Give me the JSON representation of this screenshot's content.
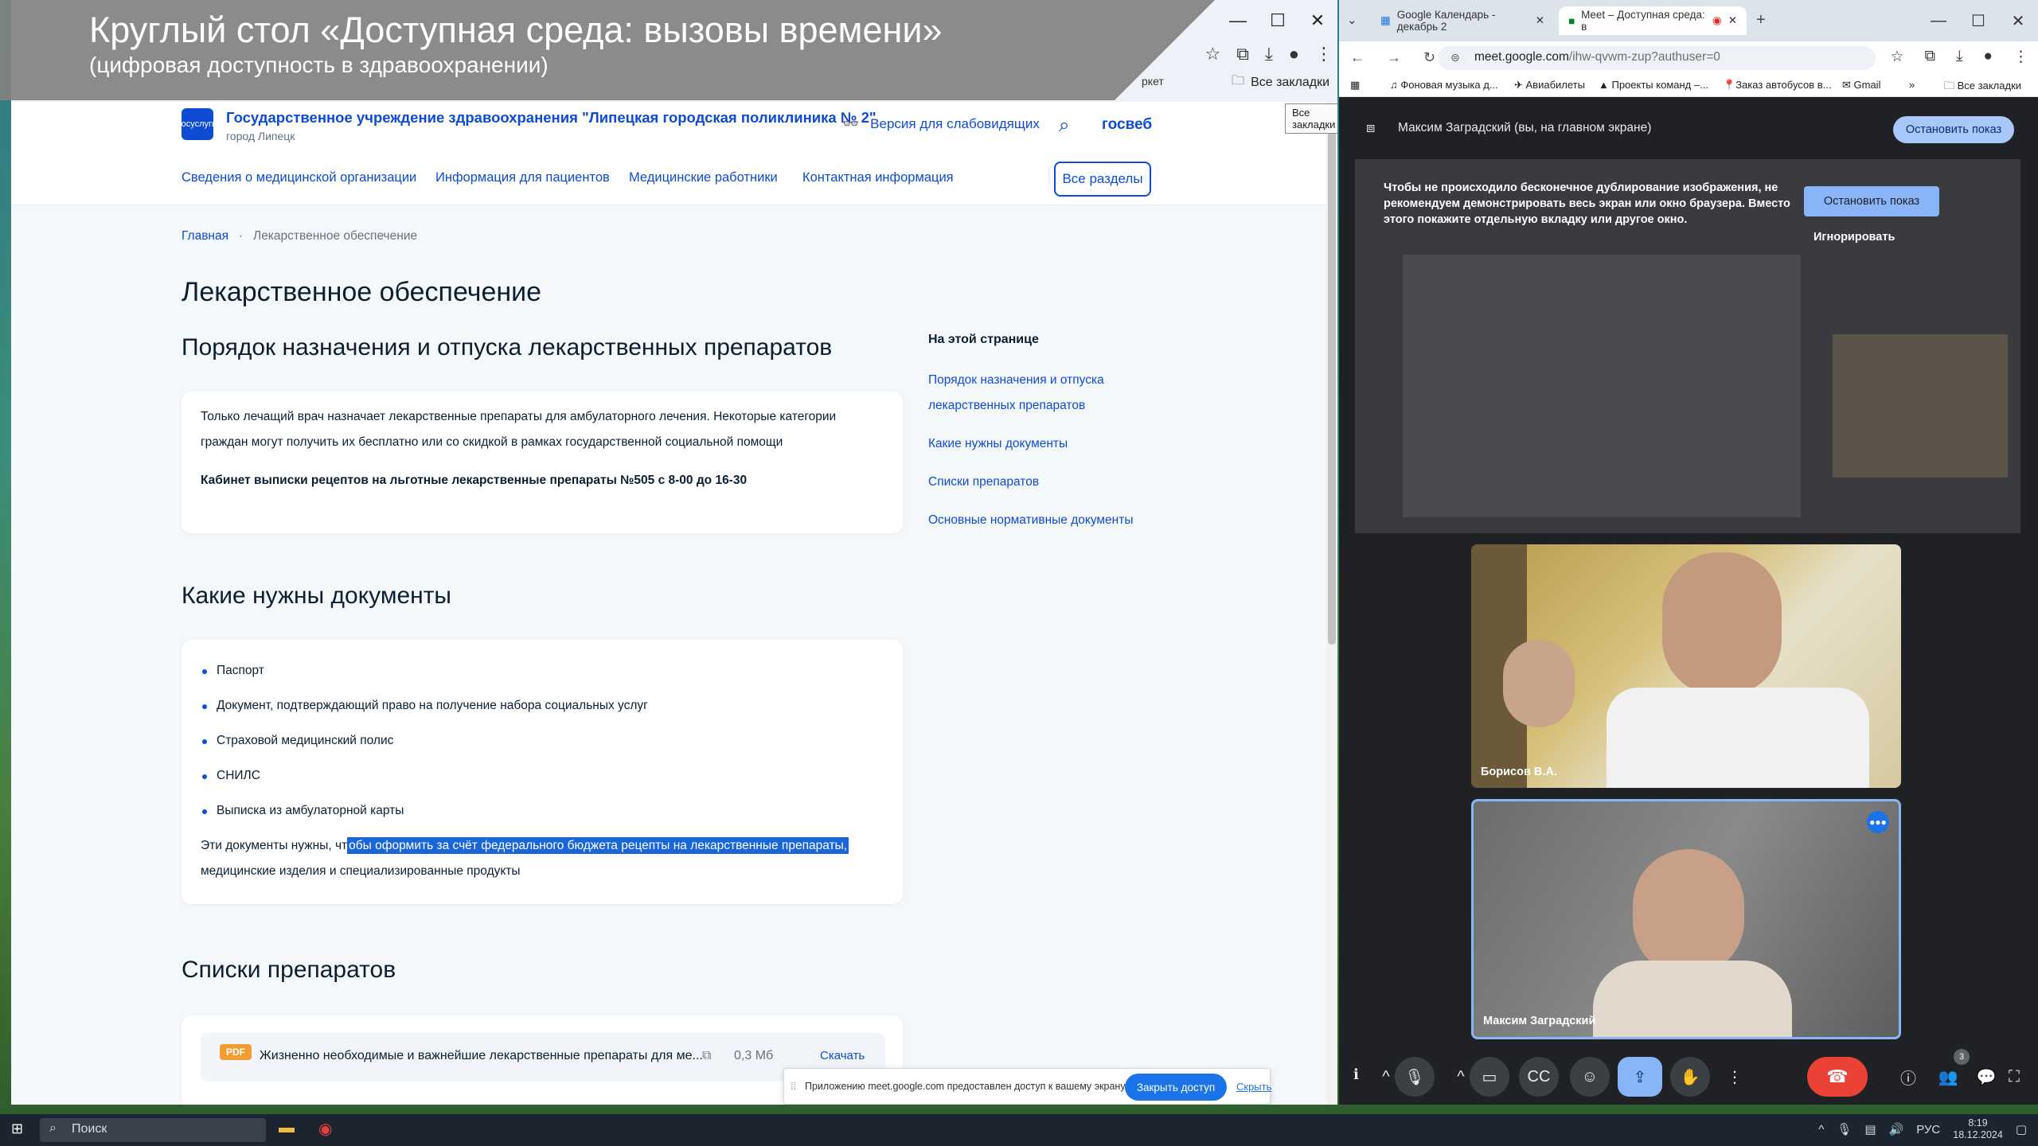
{
  "caption": {
    "title": "Круглый стол «Доступная среда: вызовы времени»",
    "subtitle": "(цифровая доступность в здравоохранении)"
  },
  "left_browser": {
    "window_buttons": [
      "—",
      "☐",
      "✕"
    ],
    "bookmark_fragment": "ркет",
    "all_bookmarks": "Все закладки",
    "tooltip": "Все закладки",
    "site": {
      "logo_text": "госуслуги",
      "org_name": "Государственное учреждение здравоохранения \"Липецкая городская поликлиника № 2\"",
      "org_city": "город Липецк",
      "accessibility_link": "Версия для слабовидящих",
      "gosweb": "госвеб",
      "nav": [
        "Сведения о медицинской организации",
        "Информация для пациентов",
        "Медицинские работники",
        "Контактная информация"
      ],
      "all_sections": "Все разделы",
      "breadcrumb_home": "Главная",
      "breadcrumb_sep": "·",
      "breadcrumb_current": "Лекарственное обеспечение",
      "page_title": "Лекарственное обеспечение",
      "section1_title": "Порядок назначения и отпуска лекарственных препаратов",
      "section1_text": "Только лечащий врач назначает лекарственные препараты для амбулаторного лечения. Некоторые категории граждан могут получить их бесплатно или со скидкой в рамках государственной социальной помощи",
      "section1_bold": "Кабинет выписки рецептов на льготные лекарственные препараты №505  с 8-00 до 16-30",
      "toc_title": "На этой странице",
      "toc_items": [
        "Порядок назначения и отпуска лекарственных препаратов",
        "Какие нужны документы",
        "Списки препаратов",
        "Основные нормативные документы"
      ],
      "section2_title": "Какие нужны документы",
      "documents": [
        "Паспорт",
        "Документ, подтверждающий право на получение набора социальных услуг",
        "Страховой медицинский полис",
        "СНИЛС",
        "Выписка из амбулаторной карты"
      ],
      "docs_note_pre": "Эти документы нужны, чт",
      "docs_note_hl": "обы оформить за счёт федерального бюджета рецепты на лекарственные препараты,",
      "docs_note_post": "медицинские изделия и специализированные продукты",
      "section3_title": "Списки препаратов",
      "pdf_badge": "PDF",
      "pdf_name": "Жизненно необходимые и важнейшие лекарственные препараты для ме...",
      "pdf_size": "0,3 Мб",
      "pdf_download": "Скачать"
    },
    "share_bar": {
      "text": "Приложению meet.google.com предоставлен доступ к вашему экрану.",
      "close_button": "Закрыть доступ",
      "hide_link": "Скрыть"
    }
  },
  "right_browser": {
    "tabs": [
      {
        "label": "Google Календарь - декабрь 2"
      },
      {
        "label": "Meet – Доступная среда: в"
      }
    ],
    "window_buttons": [
      "—",
      "☐",
      "✕"
    ],
    "url_host": "meet.google.com",
    "url_path": "/ihw-qvwm-zup?authuser=0",
    "bookmarks": [
      "Фоновая музыка д...",
      "Авиабилеты",
      "Проекты команд –...",
      "Заказ автобусов в...",
      "Gmail"
    ],
    "all_bookmarks": "Все закладки",
    "meet": {
      "presenting_text": "Максим Заградский (вы, на главном экране)",
      "stop_sharing": "Остановить показ",
      "warning": "Чтобы не происходило бесконечное дублирование изображения, не рекомендуем демонстрировать весь экран или окно браузера. Вместо этого покажите отдельную вкладку или другое окно.",
      "preview_stop": "Остановить показ",
      "preview_ignore": "Игнорировать",
      "participants": [
        {
          "name": "Борисов В.А."
        },
        {
          "name": "Максим Заградский"
        }
      ],
      "people_count": "3"
    }
  },
  "taskbar": {
    "search_placeholder": "Поиск",
    "lang": "РУС",
    "time": "8:19",
    "date": "18.12.2024"
  },
  "colors": {
    "gosweb_blue": "#0d4cd3",
    "meet_dark": "#202124",
    "end_call_red": "#ea4335",
    "selection_blue": "#1a66d9"
  }
}
